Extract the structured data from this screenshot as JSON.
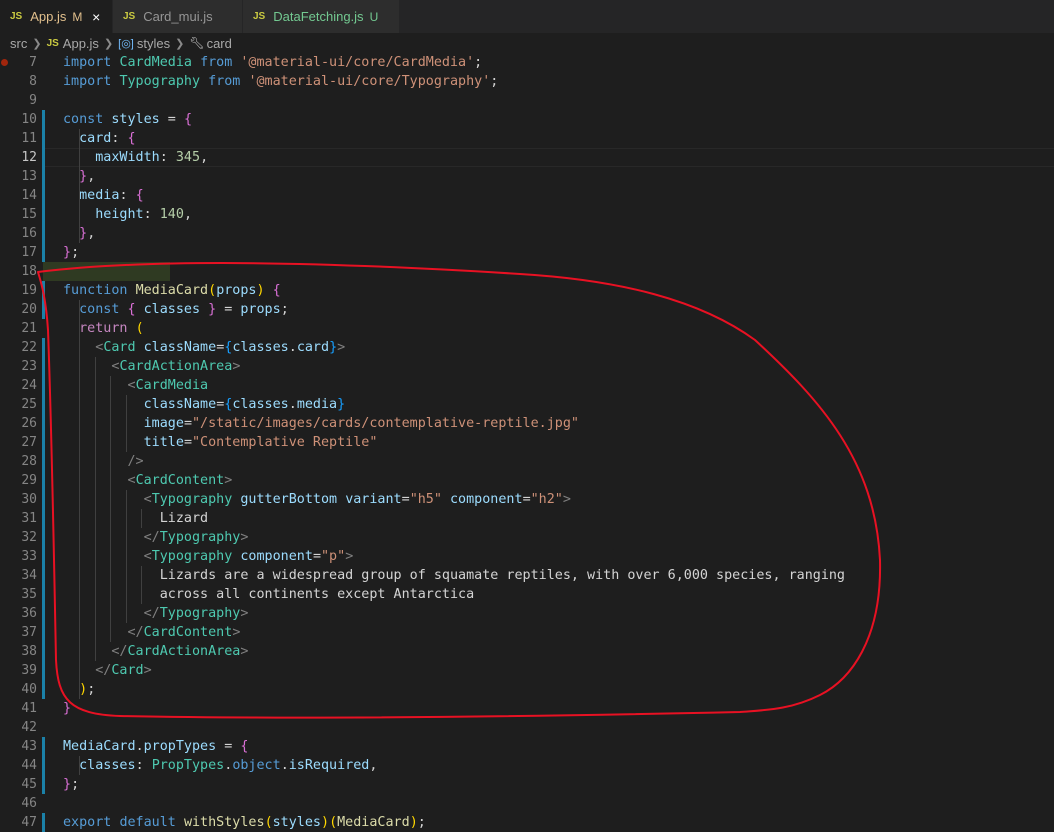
{
  "tabs": [
    {
      "label": "App.js",
      "badge": "M",
      "close": "×",
      "icon": "JS"
    },
    {
      "label": "Card_mui.js",
      "badge": "",
      "icon": "JS"
    },
    {
      "label": "DataFetching.js",
      "badge": "U",
      "icon": "JS"
    }
  ],
  "breadcrumb": {
    "folder": "src",
    "file": "App.js",
    "symbol1": "styles",
    "symbol2": "card",
    "file_icon": "JS"
  },
  "editor": {
    "current_line": 12,
    "lines": [
      {
        "n": "7",
        "text": "import CardMedia from '@material-ui/core/CardMedia';"
      },
      {
        "n": "8",
        "text": "import Typography from '@material-ui/core/Typography';"
      },
      {
        "n": "9",
        "text": ""
      },
      {
        "n": "10",
        "text": "const styles = {"
      },
      {
        "n": "11",
        "text": "  card: {"
      },
      {
        "n": "12",
        "text": "    maxWidth: 345,"
      },
      {
        "n": "13",
        "text": "  },"
      },
      {
        "n": "14",
        "text": "  media: {"
      },
      {
        "n": "15",
        "text": "    height: 140,"
      },
      {
        "n": "16",
        "text": "  },"
      },
      {
        "n": "17",
        "text": "};"
      },
      {
        "n": "18",
        "text": ""
      },
      {
        "n": "19",
        "text": "function MediaCard(props) {"
      },
      {
        "n": "20",
        "text": "  const { classes } = props;"
      },
      {
        "n": "21",
        "text": "  return ("
      },
      {
        "n": "22",
        "text": "    <Card className={classes.card}>"
      },
      {
        "n": "23",
        "text": "      <CardActionArea>"
      },
      {
        "n": "24",
        "text": "        <CardMedia"
      },
      {
        "n": "25",
        "text": "          className={classes.media}"
      },
      {
        "n": "26",
        "text": "          image=\"/static/images/cards/contemplative-reptile.jpg\""
      },
      {
        "n": "27",
        "text": "          title=\"Contemplative Reptile\""
      },
      {
        "n": "28",
        "text": "        />"
      },
      {
        "n": "29",
        "text": "        <CardContent>"
      },
      {
        "n": "30",
        "text": "          <Typography gutterBottom variant=\"h5\" component=\"h2\">"
      },
      {
        "n": "31",
        "text": "            Lizard"
      },
      {
        "n": "32",
        "text": "          </Typography>"
      },
      {
        "n": "33",
        "text": "          <Typography component=\"p\">"
      },
      {
        "n": "34",
        "text": "            Lizards are a widespread group of squamate reptiles, with over 6,000 species, ranging"
      },
      {
        "n": "35",
        "text": "            across all continents except Antarctica"
      },
      {
        "n": "36",
        "text": "          </Typography>"
      },
      {
        "n": "37",
        "text": "        </CardContent>"
      },
      {
        "n": "38",
        "text": "      </CardActionArea>"
      },
      {
        "n": "39",
        "text": "    </Card>"
      },
      {
        "n": "40",
        "text": "  );"
      },
      {
        "n": "41",
        "text": "}"
      },
      {
        "n": "42",
        "text": ""
      },
      {
        "n": "43",
        "text": "MediaCard.propTypes = {"
      },
      {
        "n": "44",
        "text": "  classes: PropTypes.object.isRequired,"
      },
      {
        "n": "45",
        "text": "};"
      },
      {
        "n": "46",
        "text": ""
      },
      {
        "n": "47",
        "text": "export default withStyles(styles)(MediaCard);"
      }
    ]
  },
  "colors": {
    "background": "#1e1e1e",
    "keyword": "#569cd6",
    "control": "#c586c0",
    "variable": "#9cdcfe",
    "class": "#4ec9b0",
    "function": "#dcdcaa",
    "string": "#ce9178",
    "number": "#b5cea8",
    "annotation": "#e81123"
  },
  "annotation": {
    "type": "freehand-circle",
    "color": "#e81123"
  }
}
